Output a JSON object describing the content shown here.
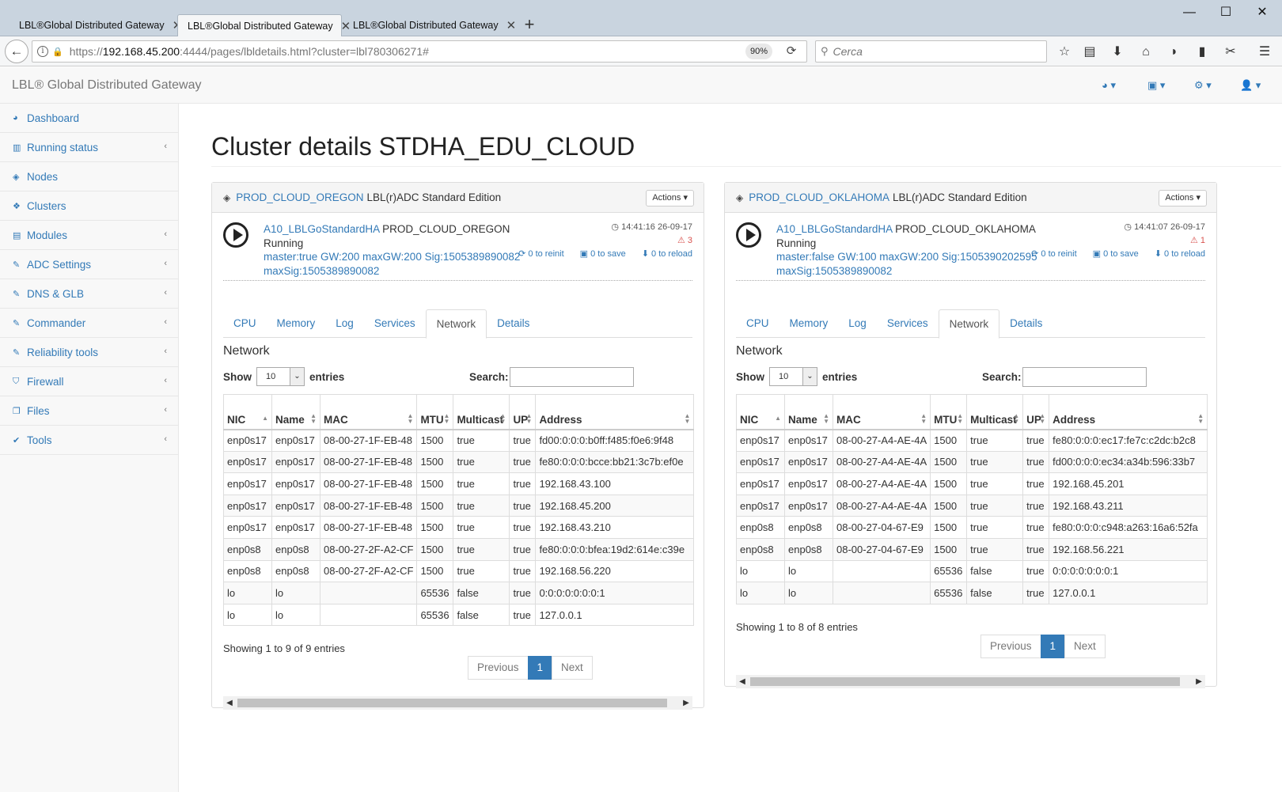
{
  "browser": {
    "tabs": [
      {
        "title": "LBL®Global Distributed Gateway"
      },
      {
        "title": "LBL®Global Distributed Gateway"
      },
      {
        "title": "LBL®Global Distributed Gateway"
      }
    ],
    "url_prefix": "https://",
    "url_host": "192.168.45.200",
    "url_rest": ":4444/pages/lbldetails.html?cluster=lbl780306271#",
    "zoom": "90%",
    "search_placeholder": "Cerca"
  },
  "app": {
    "brand": "LBL® Global Distributed Gateway"
  },
  "sidebar": {
    "items": [
      {
        "label": "Dashboard",
        "icon": "dashboard-icon",
        "chevron": false
      },
      {
        "label": "Running status",
        "icon": "bar-chart-icon",
        "chevron": true
      },
      {
        "label": "Nodes",
        "icon": "cube-icon",
        "chevron": false
      },
      {
        "label": "Clusters",
        "icon": "cubes-icon",
        "chevron": false
      },
      {
        "label": "Modules",
        "icon": "list-icon",
        "chevron": true
      },
      {
        "label": "ADC Settings",
        "icon": "edit-icon",
        "chevron": true
      },
      {
        "label": "DNS & GLB",
        "icon": "edit-icon",
        "chevron": true
      },
      {
        "label": "Commander",
        "icon": "edit-icon",
        "chevron": true
      },
      {
        "label": "Reliability tools",
        "icon": "edit-icon",
        "chevron": true
      },
      {
        "label": "Firewall",
        "icon": "shield-icon",
        "chevron": true
      },
      {
        "label": "Files",
        "icon": "files-icon",
        "chevron": true
      },
      {
        "label": "Tools",
        "icon": "wrench-icon",
        "chevron": true
      }
    ]
  },
  "main": {
    "title": "Cluster details STDHA_EDU_CLOUD",
    "tab_labels": [
      "CPU",
      "Memory",
      "Log",
      "Services",
      "Network",
      "Details"
    ],
    "active_tab": "Network",
    "section_title": "Network",
    "show_label": "Show",
    "show_value": "10",
    "entries_label": "entries",
    "search_label": "Search:",
    "actions_label": "Actions",
    "previous_label": "Previous",
    "next_label": "Next",
    "current_page": "1",
    "columns": [
      "NIC",
      "Name",
      "MAC",
      "MTU",
      "Multicast",
      "UP",
      "Address"
    ],
    "panels": [
      {
        "node": "PROD_CLOUD_OREGON",
        "edition": "LBL(r)ADC Standard Edition",
        "service": "A10_LBLGoStandardHA",
        "service_node": "PROD_CLOUD_OREGON",
        "status": "Running",
        "detail1": "master:true GW:200 maxGW:200 Sig:1505389890082",
        "detail2": "maxSig:1505389890082",
        "timestamp": "14:41:16 26-09-17",
        "warnings": "3",
        "reinit": "0 to reinit",
        "save": "0 to save",
        "reload": "0 to reload",
        "rows": [
          [
            "enp0s17",
            "enp0s17",
            "08-00-27-1F-EB-48",
            "1500",
            "true",
            "true",
            "fd00:0:0:0:b0ff:f485:f0e6:9f48"
          ],
          [
            "enp0s17",
            "enp0s17",
            "08-00-27-1F-EB-48",
            "1500",
            "true",
            "true",
            "fe80:0:0:0:bcce:bb21:3c7b:ef0e"
          ],
          [
            "enp0s17",
            "enp0s17",
            "08-00-27-1F-EB-48",
            "1500",
            "true",
            "true",
            "192.168.43.100"
          ],
          [
            "enp0s17",
            "enp0s17",
            "08-00-27-1F-EB-48",
            "1500",
            "true",
            "true",
            "192.168.45.200"
          ],
          [
            "enp0s17",
            "enp0s17",
            "08-00-27-1F-EB-48",
            "1500",
            "true",
            "true",
            "192.168.43.210"
          ],
          [
            "enp0s8",
            "enp0s8",
            "08-00-27-2F-A2-CF",
            "1500",
            "true",
            "true",
            "fe80:0:0:0:bfea:19d2:614e:c39e"
          ],
          [
            "enp0s8",
            "enp0s8",
            "08-00-27-2F-A2-CF",
            "1500",
            "true",
            "true",
            "192.168.56.220"
          ],
          [
            "lo",
            "lo",
            "",
            "65536",
            "false",
            "true",
            "0:0:0:0:0:0:0:1"
          ],
          [
            "lo",
            "lo",
            "",
            "65536",
            "false",
            "true",
            "127.0.0.1"
          ]
        ],
        "info": "Showing 1 to 9 of 9 entries"
      },
      {
        "node": "PROD_CLOUD_OKLAHOMA",
        "edition": "LBL(r)ADC Standard Edition",
        "service": "A10_LBLGoStandardHA",
        "service_node": "PROD_CLOUD_OKLAHOMA",
        "status": "Running",
        "detail1": "master:false GW:100 maxGW:200 Sig:1505390202595",
        "detail2": "maxSig:1505389890082",
        "timestamp": "14:41:07 26-09-17",
        "warnings": "1",
        "reinit": "0 to reinit",
        "save": "0 to save",
        "reload": "0 to reload",
        "rows": [
          [
            "enp0s17",
            "enp0s17",
            "08-00-27-A4-AE-4A",
            "1500",
            "true",
            "true",
            "fe80:0:0:0:ec17:fe7c:c2dc:b2c8"
          ],
          [
            "enp0s17",
            "enp0s17",
            "08-00-27-A4-AE-4A",
            "1500",
            "true",
            "true",
            "fd00:0:0:0:ec34:a34b:596:33b7"
          ],
          [
            "enp0s17",
            "enp0s17",
            "08-00-27-A4-AE-4A",
            "1500",
            "true",
            "true",
            "192.168.45.201"
          ],
          [
            "enp0s17",
            "enp0s17",
            "08-00-27-A4-AE-4A",
            "1500",
            "true",
            "true",
            "192.168.43.211"
          ],
          [
            "enp0s8",
            "enp0s8",
            "08-00-27-04-67-E9",
            "1500",
            "true",
            "true",
            "fe80:0:0:0:c948:a263:16a6:52fa"
          ],
          [
            "enp0s8",
            "enp0s8",
            "08-00-27-04-67-E9",
            "1500",
            "true",
            "true",
            "192.168.56.221"
          ],
          [
            "lo",
            "lo",
            "",
            "65536",
            "false",
            "true",
            "0:0:0:0:0:0:0:1"
          ],
          [
            "lo",
            "lo",
            "",
            "65536",
            "false",
            "true",
            "127.0.0.1"
          ]
        ],
        "info": "Showing 1 to 8 of 8 entries"
      }
    ]
  },
  "colors": {
    "link": "#337ab7",
    "warning": "#d9534f",
    "page_active": "#337ab7"
  }
}
